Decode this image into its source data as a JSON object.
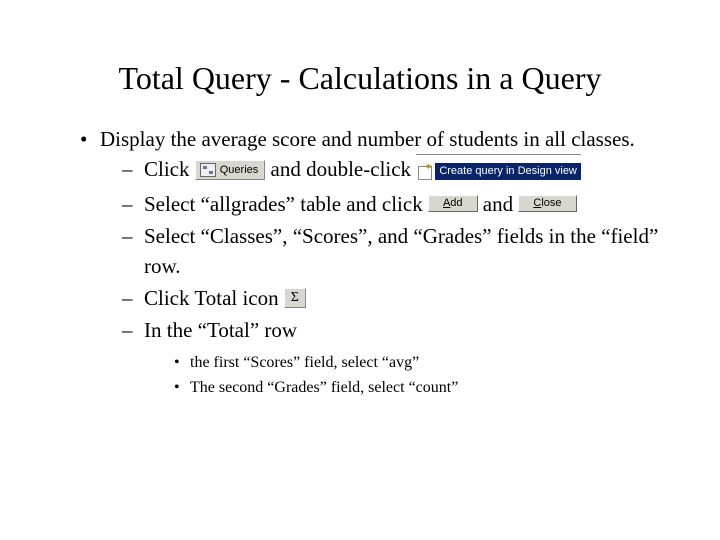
{
  "title": "Total Query - Calculations in a Query",
  "bullet1": "Display the average score and number of students in all classes.",
  "sub": {
    "a_pre": "Click ",
    "a_mid": " and double-click ",
    "b_pre": "Select “allgrades” table and click ",
    "b_mid": " and ",
    "c": "Select “Classes”, “Scores”, and “Grades” fields in the “field” row.",
    "d": " Click Total icon ",
    "e": "In the “Total” row"
  },
  "subsub": {
    "a": "the first “Scores” field, select “avg”",
    "b": "The second “Grades” field, select “count”"
  },
  "buttons": {
    "queries": "Queries",
    "create": "Create query in Design view",
    "add_u": "A",
    "add_rest": "dd",
    "close_u": "C",
    "close_rest": "lose",
    "sigma": "Σ"
  }
}
